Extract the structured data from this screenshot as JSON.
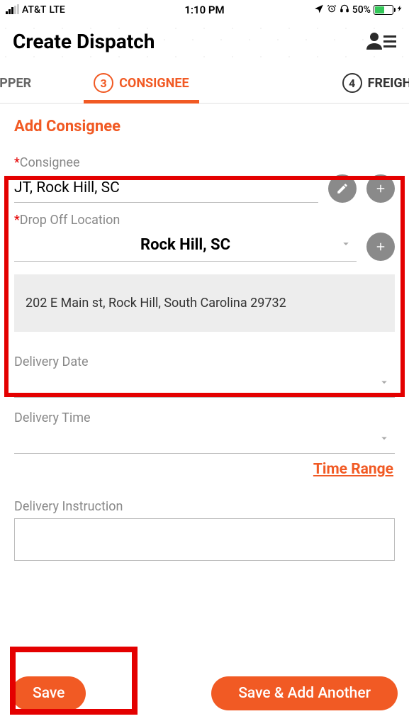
{
  "status": {
    "carrier": "AT&T",
    "network": "LTE",
    "time": "1:10 PM",
    "battery_pct": "50%"
  },
  "header": {
    "title": "Create Dispatch"
  },
  "tabs": {
    "left_label": "IPPER",
    "active_num": "3",
    "active_label": "CONSIGNEE",
    "right_num": "4",
    "right_label": "FREIGHT D"
  },
  "section": {
    "title": "Add Consignee"
  },
  "form": {
    "consignee_label": "Consignee",
    "consignee_value": "JT, Rock Hill, SC",
    "dropoff_label": "Drop Off Location",
    "dropoff_value": "Rock Hill, SC",
    "address": "202 E Main st, Rock Hill, South Carolina 29732",
    "delivery_date_label": "Delivery Date",
    "delivery_time_label": "Delivery Time",
    "time_range_link": "Time Range",
    "delivery_instruction_label": "Delivery Instruction"
  },
  "footer": {
    "save": "Save",
    "save_add": "Save & Add Another"
  }
}
